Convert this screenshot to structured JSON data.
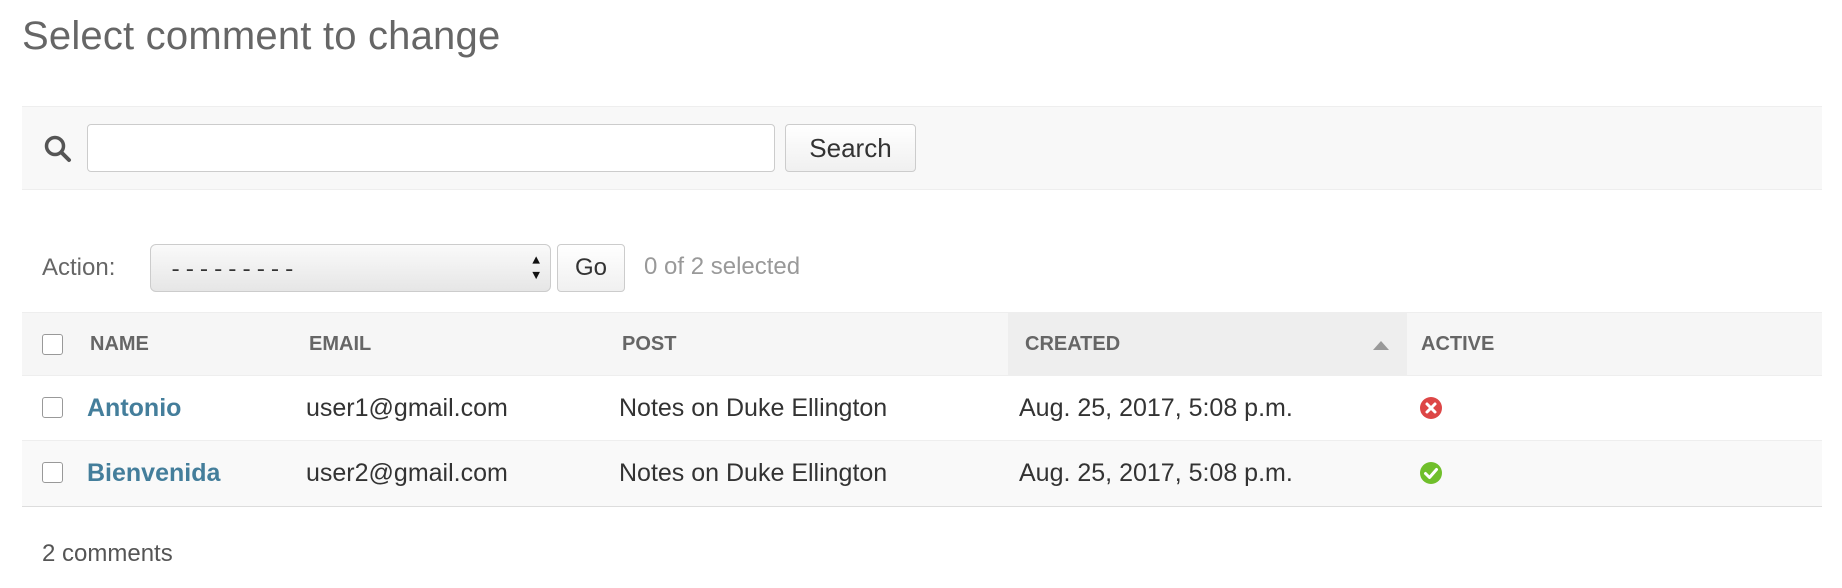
{
  "page": {
    "title": "Select comment to change"
  },
  "search": {
    "value": "",
    "placeholder": "",
    "button_label": "Search",
    "icon": "search-icon"
  },
  "actions": {
    "label": "Action:",
    "selected_option": "---------",
    "go_label": "Go",
    "selection_counter": "0 of 2 selected"
  },
  "table": {
    "columns": [
      "Name",
      "Email",
      "Post",
      "Created",
      "Active"
    ],
    "sorted_column": "Created",
    "sort_direction": "ascending",
    "rows": [
      {
        "name": "Antonio",
        "email": "user1@gmail.com",
        "post": "Notes on Duke Ellington",
        "created": "Aug. 25, 2017, 5:08 p.m.",
        "active": false,
        "active_icon": "cross-circle-icon"
      },
      {
        "name": "Bienvenida",
        "email": "user2@gmail.com",
        "post": "Notes on Duke Ellington",
        "created": "Aug. 25, 2017, 5:08 p.m.",
        "active": true,
        "active_icon": "check-circle-icon"
      }
    ]
  },
  "paginator": {
    "text": "2 comments"
  },
  "colors": {
    "link": "#447e9b",
    "active_yes": "#70bf2b",
    "active_no": "#dd4646",
    "header_bg": "#f6f6f6",
    "sorted_header_bg": "#eeeeee"
  }
}
